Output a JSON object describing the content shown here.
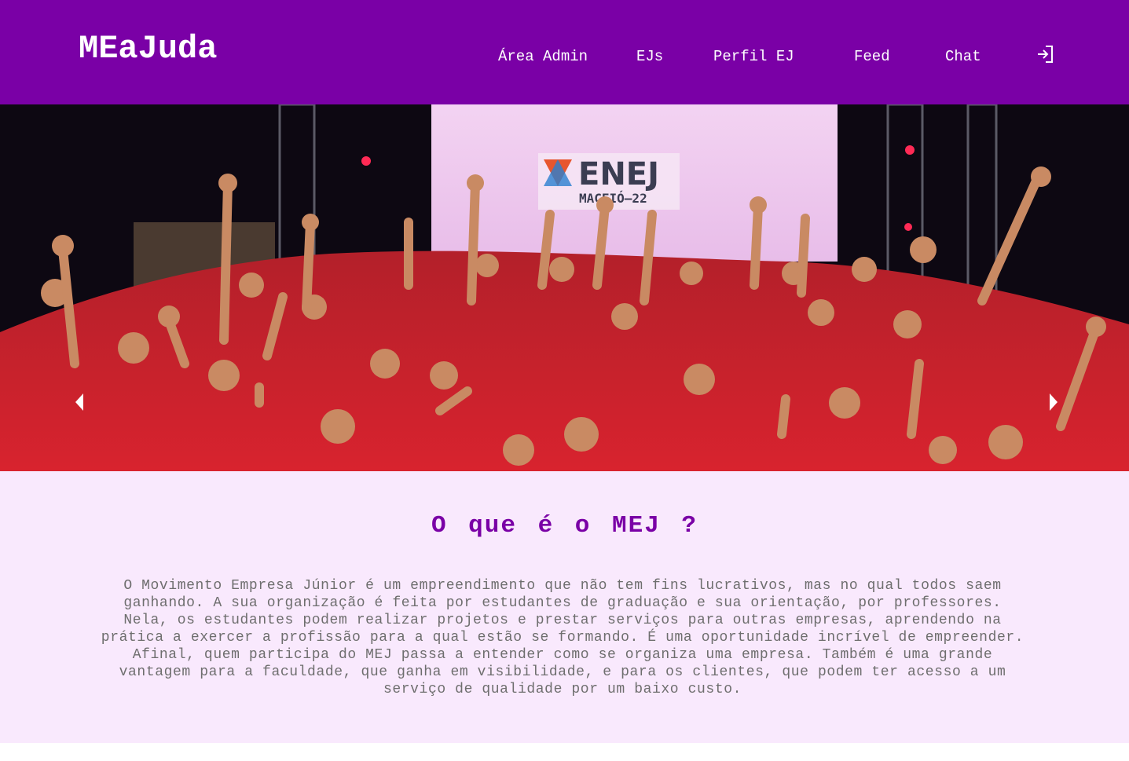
{
  "brand": {
    "name": "MEaJuda"
  },
  "nav": {
    "items": [
      {
        "label": "Área Admin"
      },
      {
        "label": "EJs"
      },
      {
        "label": "Perfil EJ"
      },
      {
        "label": "Feed"
      },
      {
        "label": "Chat"
      }
    ],
    "login_icon": "login-icon"
  },
  "hero": {
    "sign_text": "ENEJ",
    "sign_subtext": "MACEIÓ—22",
    "prev_icon": "chevron-left-icon",
    "next_icon": "chevron-right-icon"
  },
  "about": {
    "title": "O que é o MEJ ?",
    "text": "O Movimento Empresa Júnior é um empreendimento que não tem fins lucrativos, mas no qual todos saem ganhando. A sua organização é feita por estudantes de graduação e sua orientação, por professores. Nela, os estudantes podem realizar projetos e prestar serviços para outras empresas, aprendendo na prática a exercer a profissão para a qual estão se formando. É uma oportunidade incrível de empreender. Afinal, quem participa do MEJ passa a entender como se organiza uma empresa. Também é uma grande vantagem para a faculdade, que ganha em visibilidade, e para os clientes, que podem ter acesso a um serviço de qualidade por um baixo custo."
  },
  "colors": {
    "nav_bg": "#7a00a6",
    "content_bg": "#f9e9fd",
    "title_color": "#7a00a6",
    "text_color": "#6e6e6e"
  }
}
